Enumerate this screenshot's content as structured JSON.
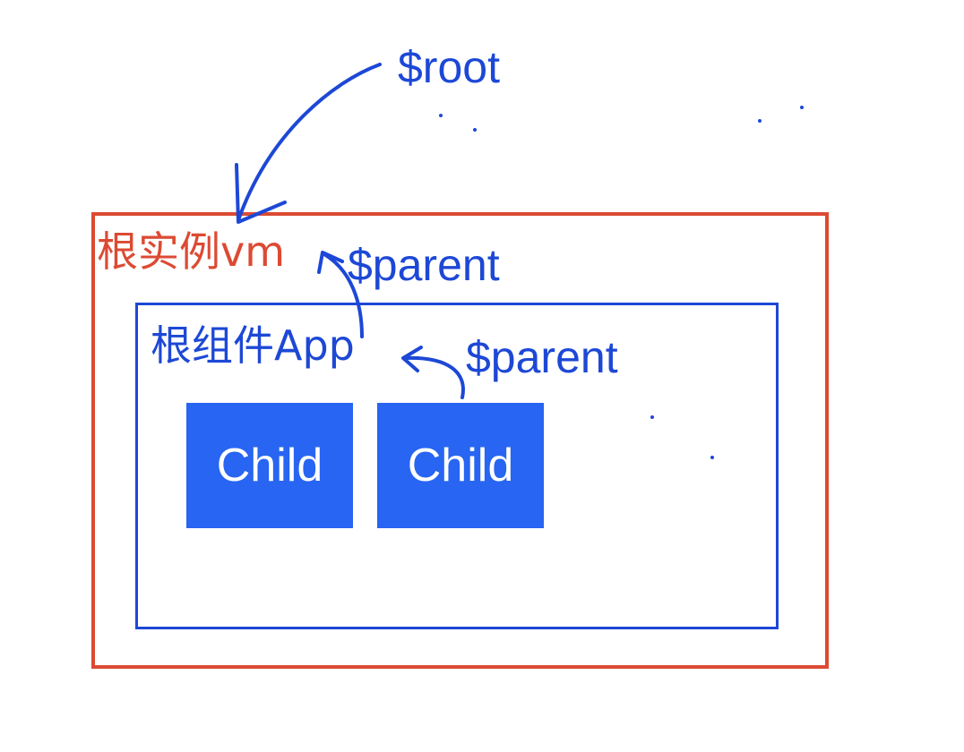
{
  "diagram": {
    "root_instance_label": "根实例vm",
    "root_component_label": "根组件App",
    "child_labels": [
      "Child",
      "Child"
    ],
    "root_ref_label": "$root",
    "parent_ref_labels": [
      "$parent",
      "$parent"
    ]
  },
  "colors": {
    "root_instance_border": "#dc4a33",
    "root_component_border": "#1d48d6",
    "child_fill": "#2765f2",
    "annotation_ink": "#1d48d6"
  }
}
